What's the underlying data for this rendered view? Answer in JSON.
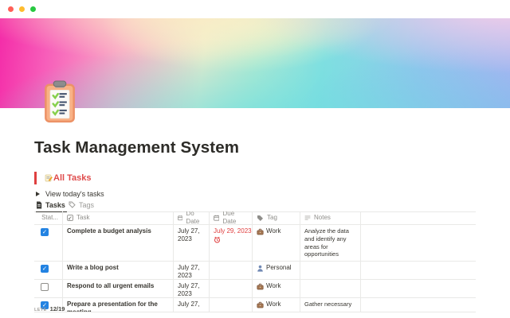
{
  "window": {
    "traffic_lights": {
      "close": "#ff5f57",
      "minimize": "#febc2e",
      "zoom": "#28c840"
    }
  },
  "page": {
    "title": "Task Management System",
    "icon": "clipboard-icon",
    "cover": "rainbow-gradient",
    "callout": {
      "icon": "memo-icon",
      "text": "All Tasks",
      "color": "#df4b4b"
    },
    "toggle": {
      "label": "View today's tasks"
    },
    "tabs": [
      {
        "label": "Tasks",
        "icon": "page-icon",
        "active": true
      },
      {
        "label": "Tags",
        "icon": "tag-icon",
        "active": false
      }
    ]
  },
  "table": {
    "columns": [
      {
        "key": "status",
        "label": "Stat...",
        "icon": "status-icon"
      },
      {
        "key": "task",
        "label": "Task",
        "icon": "pencil-square-icon"
      },
      {
        "key": "do_date",
        "label": "Do Date",
        "icon": "calendar-icon"
      },
      {
        "key": "due_date",
        "label": "Due Date",
        "icon": "calendar-icon"
      },
      {
        "key": "tag",
        "label": "Tag",
        "icon": "tag-icon"
      },
      {
        "key": "notes",
        "label": "Notes",
        "icon": "text-lines-icon"
      }
    ],
    "rows": [
      {
        "checked": true,
        "task": "Complete a budget analysis",
        "do_date": "July 27, 2023",
        "due_date": "July 29, 2023",
        "due_overdue": true,
        "tag": {
          "icon": "briefcase-icon",
          "label": "Work"
        },
        "notes": "Analyze the data and identify any areas for opportunities"
      },
      {
        "checked": true,
        "task": "Write a blog post",
        "do_date": "July 27, 2023",
        "due_date": "",
        "tag": {
          "icon": "person-icon",
          "label": "Personal"
        },
        "notes": ""
      },
      {
        "checked": false,
        "task": "Respond to all urgent emails",
        "do_date": "July 27, 2023",
        "due_date": "",
        "tag": {
          "icon": "briefcase-icon",
          "label": "Work"
        },
        "notes": ""
      },
      {
        "checked": true,
        "task": "Prepare a presentation for the meeting",
        "do_date": "July 27,",
        "due_date": "",
        "tag": {
          "icon": "briefcase-icon",
          "label": "Work"
        },
        "notes": "Gather necessary"
      }
    ],
    "footer": {
      "aggregate_label": "LETE",
      "value": "12/19"
    }
  }
}
